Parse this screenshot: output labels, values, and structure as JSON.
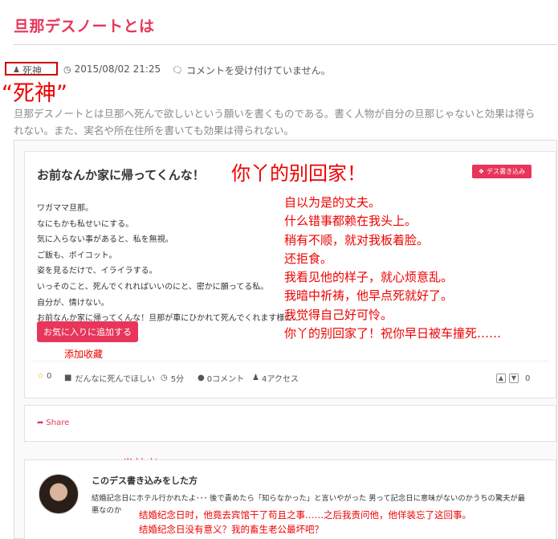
{
  "post": {
    "title": "旦那デスノートとは",
    "author": "死神",
    "date": "2015/08/02 21:25",
    "comments_status": "コメントを受け付けていません。",
    "intro_line1": "旦那デスノートとは旦那へ死んで欲しいという願いを書くものである。書く人物が自分の旦那じゃないと効果は得ら",
    "intro_line2": "れない。また、実名や所在住所を書いても効果は得られない。"
  },
  "entry": {
    "title": "お前なんか家に帰ってくんな！",
    "death_button": "デス書き込み",
    "lines": [
      "ワガママ旦那。",
      "なにもかも私せいにする。",
      "気に入らない事があると、私を無視。",
      "ご飯も、ボイコット。",
      "姿を見るだけで、イライラする。",
      "いっそのこと、死んでくれればいいのにと、密かに願ってる私。",
      "自分が、情けない。",
      "お前なんか家に帰ってくんな！旦那が車にひかれて死んでくれます様に…"
    ],
    "favorite_button": "お気に入りに追加する",
    "stats": {
      "stars": "0",
      "category": "だんなに死んでほしい",
      "time": "5分",
      "comments": "0コメント",
      "access": "4アクセス",
      "votes": "0"
    }
  },
  "share": {
    "label": "Share"
  },
  "poster": {
    "heading": "このデス書き込みをした方",
    "text_line1": "結婚記念日にホテル行かれたよ･･･ 後で責めたら「知らなかった」と言いやがった 男って記念日に意味がないのかうちの驚夫が最",
    "text_line2": "悪なのか"
  },
  "annotations": {
    "author_label": "“死神”",
    "headline": "你丫的别回家！",
    "lines": [
      "自以为是的丈夫。",
      "什么错事都赖在我头上。",
      "稍有不顺，就对我板着脸。",
      "还拒食。",
      "我看见他的样子，就心烦意乱。",
      "我暗中祈祷，他早点死就好了。",
      "我觉得自己好可怜。",
      "你丫的别回家了！祝你早日被车撞死……"
    ],
    "favorite": "添加收藏",
    "poster": "发帖者",
    "poster_line1": "结婚纪念日时，他竟去宾馆干了苟且之事……之后我责问他，他佯装忘了这回事。",
    "poster_line2": "结婚纪念日没有意义？我的畜生老公最坏吧？"
  },
  "colors": {
    "accent": "#e8355a",
    "annotation": "#e00000"
  },
  "icons": [
    "user-icon",
    "clock-icon",
    "comment-icon",
    "star-icon",
    "folder-icon",
    "thumbs-up-icon",
    "thumbs-down-icon",
    "share-icon",
    "death-icon"
  ]
}
